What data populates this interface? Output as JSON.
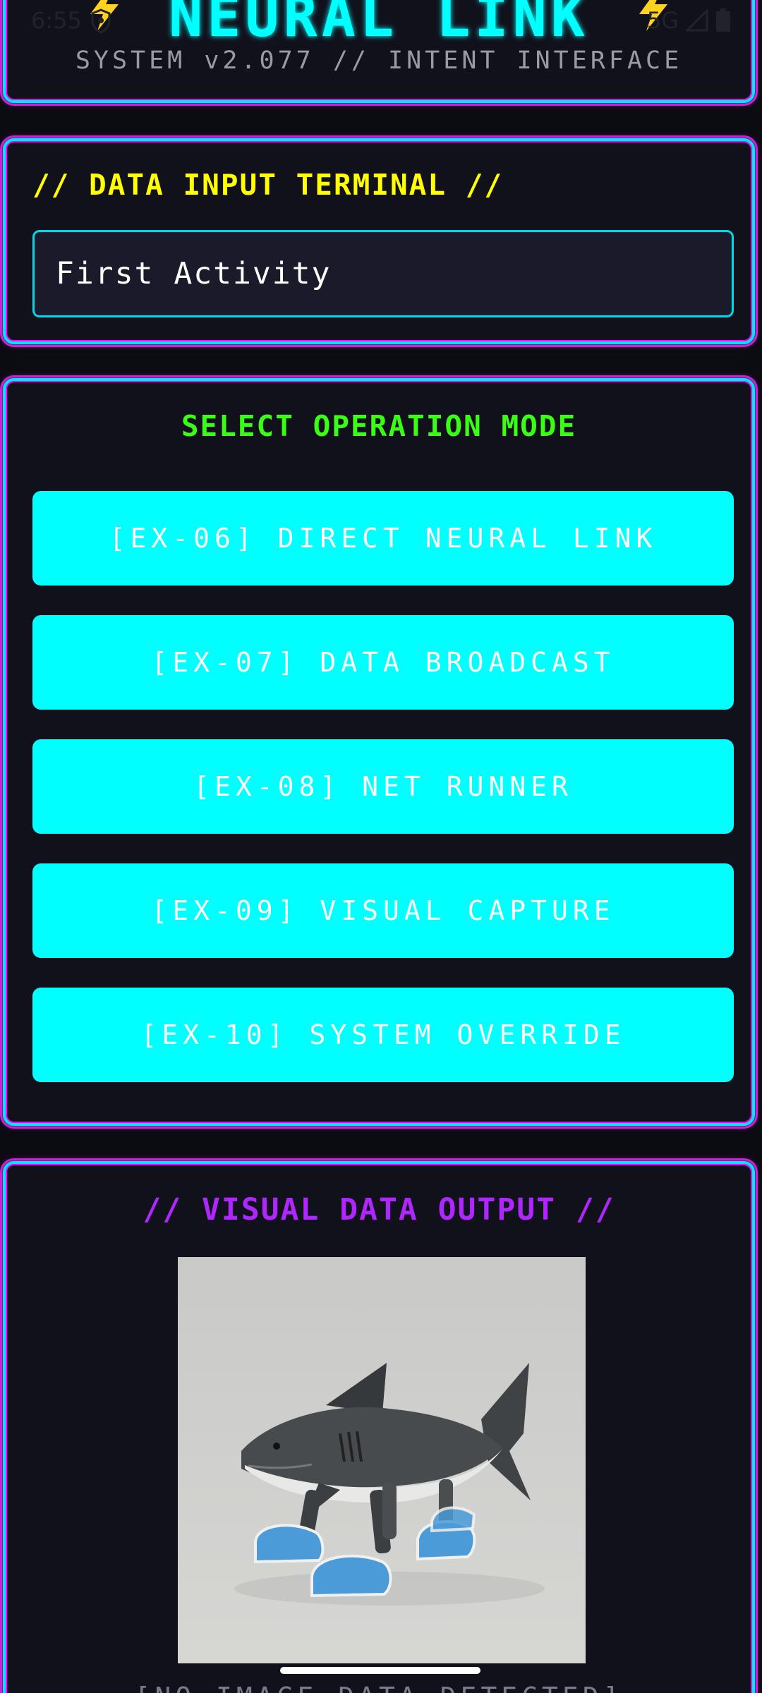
{
  "status_bar": {
    "time": "6:55",
    "network": "5G"
  },
  "header": {
    "title": "NEURAL LINK",
    "subtitle": "SYSTEM v2.077 // INTENT INTERFACE"
  },
  "input_section": {
    "label": "// DATA INPUT TERMINAL //",
    "value": "First Activity"
  },
  "operations": {
    "label": "SELECT OPERATION MODE",
    "buttons": [
      "[EX-06] DIRECT NEURAL LINK",
      "[EX-07] DATA BROADCAST",
      "[EX-08] NET RUNNER",
      "[EX-09] VISUAL CAPTURE",
      "[EX-10] SYSTEM OVERRIDE"
    ]
  },
  "visual_output": {
    "label": "// VISUAL DATA OUTPUT //",
    "image_description": "toy shark with legs wearing blue sneakers",
    "caption": "[NO IMAGE DATA DETECTED]"
  },
  "colors": {
    "cyan": "#00ffff",
    "magenta": "#ff00ff",
    "yellow": "#ffff00",
    "green": "#39ff14",
    "purple": "#b026ff",
    "background": "#0b0b12",
    "panel": "#11111c"
  }
}
